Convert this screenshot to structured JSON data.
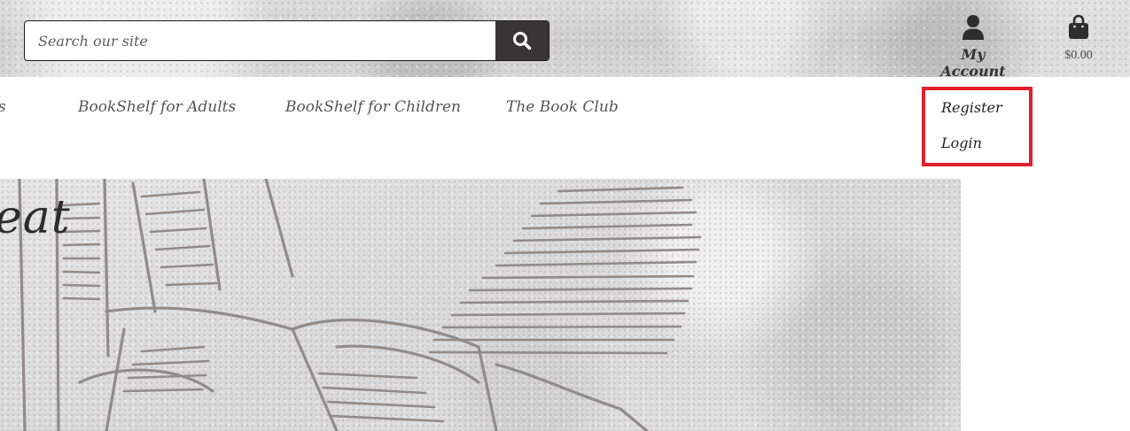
{
  "search": {
    "placeholder": "Search our site",
    "value": "",
    "button_icon": "search-icon"
  },
  "header": {
    "account_label": "My Account",
    "account_icon": "user-icon",
    "cart_total": "$0.00",
    "cart_icon": "shopping-bag-icon"
  },
  "nav": {
    "partial_item": "s",
    "items": [
      {
        "label": "BookShelf for Adults"
      },
      {
        "label": "BookShelf for Children"
      },
      {
        "label": "The Book Club"
      }
    ]
  },
  "account_dropdown": {
    "highlight_color": "#e0202b",
    "items": [
      {
        "label": "Register"
      },
      {
        "label": "Login"
      }
    ]
  },
  "hero": {
    "text": "eat"
  },
  "colors": {
    "search_button": "#393534",
    "nav_text": "#555555",
    "dropdown_border": "#e0202b"
  }
}
